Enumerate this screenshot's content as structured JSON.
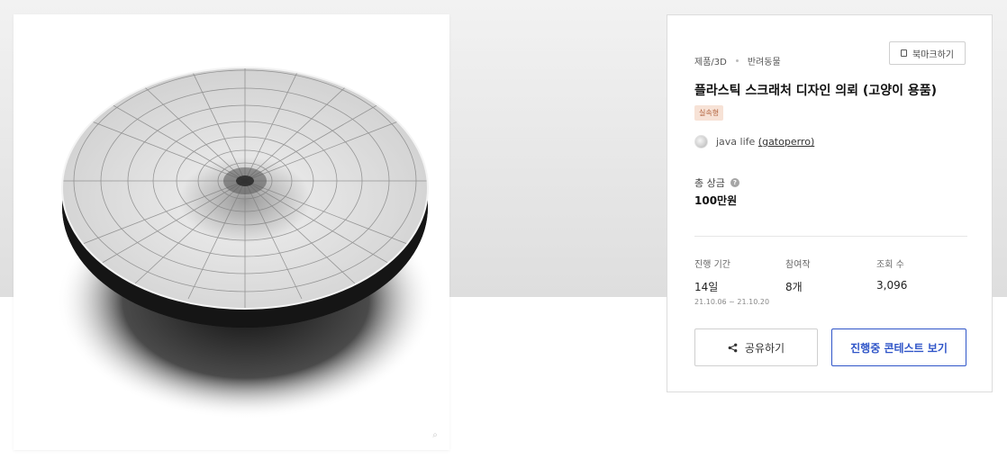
{
  "breadcrumb": {
    "category": "제품/3D",
    "subcategory": "반려동물"
  },
  "bookmark": {
    "label": "북마크하기",
    "icon": "bookmark-icon"
  },
  "contest": {
    "title": "플라스틱 스크래처 디자인 의뢰 (고양이 용품)",
    "tag": "실속형"
  },
  "author": {
    "name": "java life",
    "handle": "(gatoperro)"
  },
  "prize": {
    "label": "총 상금",
    "value": "100만원"
  },
  "stats": {
    "period_label": "진행 기간",
    "period_value": "14일",
    "period_range": "21.10.06 ~ 21.10.20",
    "entries_label": "참여작",
    "entries_value": "8개",
    "views_label": "조회 수",
    "views_value": "3,096"
  },
  "actions": {
    "share_label": "공유하기",
    "contests_label": "진행중 콘테스트 보기"
  },
  "colors": {
    "accent": "#2f55c8",
    "tag_bg": "#f7e2d6",
    "tag_text": "#b0603a"
  }
}
